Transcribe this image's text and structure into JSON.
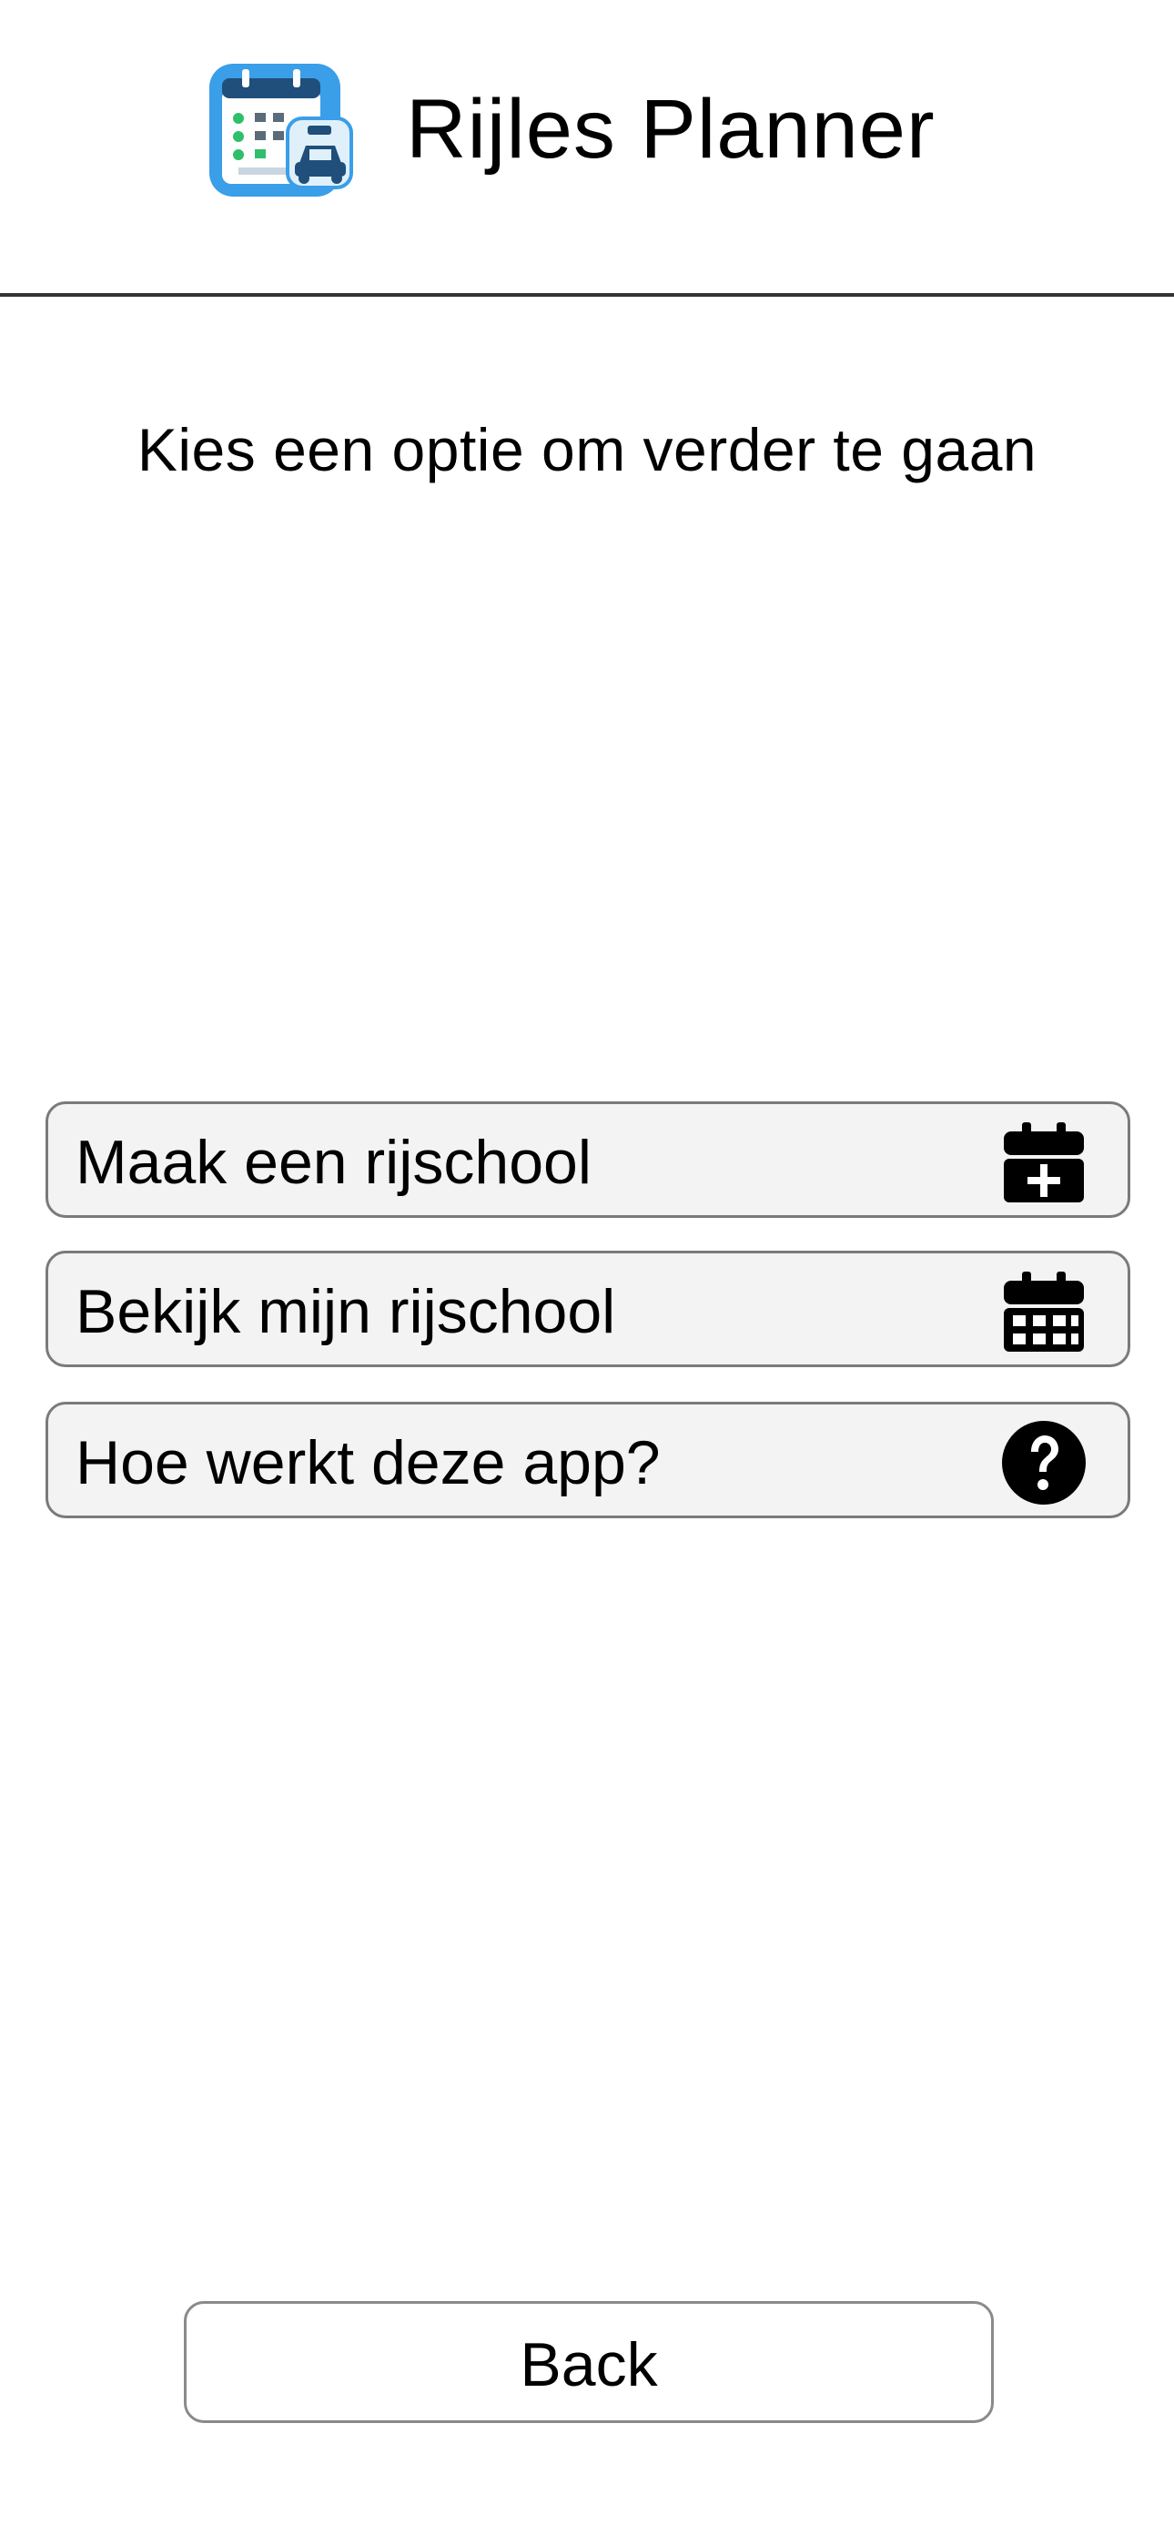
{
  "header": {
    "app_title": "Rijles Planner",
    "app_icon": "calendar-car-app-icon"
  },
  "main": {
    "subtitle": "Kies een optie om verder te gaan",
    "options": [
      {
        "label": "Maak een rijschool",
        "icon": "calendar-plus-icon"
      },
      {
        "label": "Bekijk mijn rijschool",
        "icon": "calendar-icon"
      },
      {
        "label": "Hoe werkt deze app?",
        "icon": "question-circle-icon"
      }
    ]
  },
  "footer": {
    "back_label": "Back"
  },
  "colors": {
    "background": "#ffffff",
    "button_fill": "#f3f3f3",
    "button_border": "#7a7a7a",
    "divider": "#333333",
    "icon_blue": "#3a9ee8",
    "icon_green": "#2fbf6a"
  }
}
